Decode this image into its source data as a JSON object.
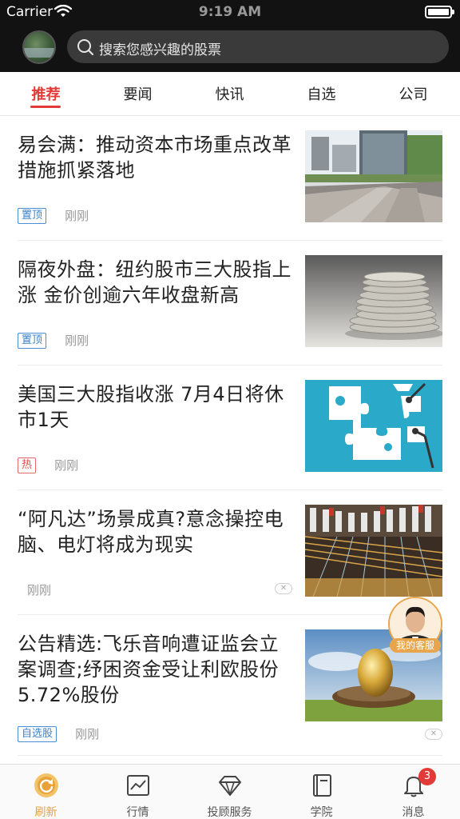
{
  "status_bar": {
    "carrier": "Carrier",
    "time": "9:19 AM"
  },
  "header": {
    "search_placeholder": "搜索您感兴趣的股票"
  },
  "tabs": [
    {
      "label": "推荐",
      "active": true
    },
    {
      "label": "要闻",
      "active": false
    },
    {
      "label": "快讯",
      "active": false
    },
    {
      "label": "自选",
      "active": false
    },
    {
      "label": "公司",
      "active": false
    }
  ],
  "news": [
    {
      "title": "易会满：推动资本市场重点改革措施抓紧落地",
      "tag": "置顶",
      "time": "刚刚",
      "image": "office-buildings-image"
    },
    {
      "title": "隔夜外盘：纽约股市三大股指上涨 金价创逾六年收盘新高",
      "tag": "置顶",
      "time": "刚刚",
      "image": "coin-stack-image"
    },
    {
      "title": "美国三大股指收涨 7月4日将休市1天",
      "tag": "热",
      "time": "刚刚",
      "image": "puzzle-robot-image"
    },
    {
      "title": "“阿凡达”场景成真?意念操控电脑、电灯将成为现实",
      "tag": "",
      "time": "刚刚",
      "image": "textile-machine-image"
    },
    {
      "title": "公告精选:飞乐音响遭证监会立案调查;纾困资金受让利欧股份5.72%股份",
      "tag": "自选股",
      "time": "刚刚",
      "image": "golden-egg-nest-image"
    }
  ],
  "service_button": {
    "label": "我的客服"
  },
  "bottom_nav": [
    {
      "label": "刷新",
      "icon": "refresh-icon",
      "active": true
    },
    {
      "label": "行情",
      "icon": "chart-icon",
      "active": false
    },
    {
      "label": "投顾服务",
      "icon": "diamond-icon",
      "active": false
    },
    {
      "label": "学院",
      "icon": "book-icon",
      "active": false
    },
    {
      "label": "消息",
      "icon": "bell-icon",
      "active": false,
      "badge": "3"
    }
  ],
  "colors": {
    "accent_red": "#e23a36",
    "accent_orange": "#e5a043",
    "tag_blue": "#3a7fc8",
    "header_bg": "#121212"
  }
}
